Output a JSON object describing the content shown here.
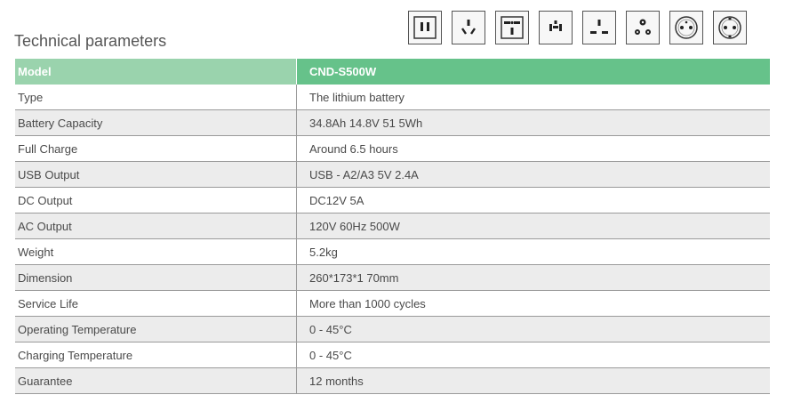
{
  "title": "Technical parameters",
  "socket_icons": [
    "us-socket-icon",
    "au-socket-icon",
    "universal-socket-icon",
    "us-ground-socket-icon",
    "uk-socket-icon",
    "in-socket-icon",
    "fr-socket-icon",
    "eu-schuko-socket-icon"
  ],
  "table": {
    "header": {
      "label": "Model",
      "value": "CND-S500W"
    },
    "rows": [
      {
        "label": "Type",
        "value": "The lithium battery"
      },
      {
        "label": "Battery Capacity",
        "value": "34.8Ah 14.8V 51 5Wh"
      },
      {
        "label": "Full Charge",
        "value": "Around 6.5 hours"
      },
      {
        "label": "USB Output",
        "value": "USB - A2/A3 5V 2.4A"
      },
      {
        "label": "DC Output",
        "value": "DC12V 5A"
      },
      {
        "label": "AC Output",
        "value": "120V 60Hz 500W"
      },
      {
        "label": "Weight",
        "value": "5.2kg"
      },
      {
        "label": "Dimension",
        "value": "260*173*1 70mm"
      },
      {
        "label": "Service Life",
        "value": "More than 1000 cycles"
      },
      {
        "label": "Operating Temperature",
        "value": "0 - 45°C"
      },
      {
        "label": "Charging Temperature",
        "value": "0 - 45°C"
      },
      {
        "label": "Guarantee",
        "value": "12 months"
      }
    ]
  },
  "colors": {
    "header_left": "#9ad3ad",
    "header_right": "#66c28a",
    "row_alt": "#ececec"
  }
}
